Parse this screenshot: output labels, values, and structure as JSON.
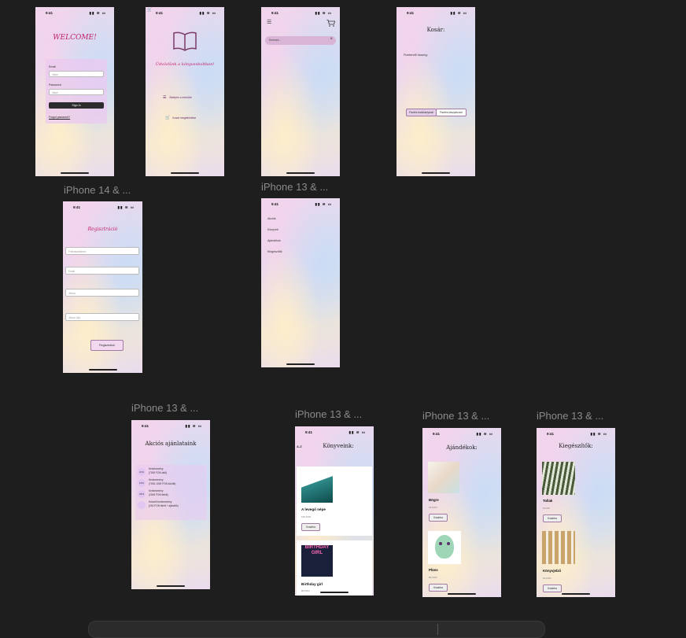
{
  "status": {
    "time": "9:41",
    "icons": "▮▮ ≋ ▭"
  },
  "labels": {
    "iphone14": "iPhone 14 & ...",
    "iphone13a": "iPhone 13 & ...",
    "iphone13b": "iPhone 13 & ...",
    "iphone13c": "iPhone 13 & ...",
    "iphone13d": "iPhone 13 & ...",
    "iphone13e": "iPhone 13 & ...",
    "iphone13f": "iPhone 13 & ..."
  },
  "login": {
    "title": "WELCOME!",
    "email_label": "Email",
    "email_placeholder": "Value",
    "password_label": "Password",
    "password_placeholder": "Value",
    "signin": "Sign In",
    "forgot": "Forgot password?"
  },
  "welcome": {
    "subtitle": "Üdvözlünk a könyvesboltban!",
    "menu1": "Belépés a menübe",
    "menu2": "Kosár megtekintése"
  },
  "search": {
    "placeholder": "Keresés...",
    "clear": "×"
  },
  "cart": {
    "title": "Kosár:",
    "total_label": "Fizetendő összeg:",
    "btn_card": "Fizetés bankkártyával",
    "btn_cash": "Fizetés készpénzzel"
  },
  "register": {
    "title": "Regisztráció",
    "username": "Felhasználónév",
    "email": "Email",
    "password": "Jelszó",
    "password2": "Jelszó újra",
    "submit": "Regisztrálok"
  },
  "menu": {
    "items": [
      "Akciók",
      "Könyvek",
      "Ajándékok",
      "Kiegészítők"
    ]
  },
  "offers": {
    "title": "Akciós ajánlataink",
    "items": [
      {
        "badge": "10%",
        "line1": "Kedvezmény",
        "line2": "(7000 FON-ától)"
      },
      {
        "badge": "15%",
        "line1": "Kedvezmény",
        "line2": "(7000-1000 FON között)"
      },
      {
        "badge": "25%",
        "line1": "Kedvezmény",
        "line2": "(2000 FON felett)"
      },
      {
        "badge": "",
        "line1": "Húsvéti kedvezmény",
        "line2": "(200 FON felett + ajándék)"
      }
    ]
  },
  "books": {
    "sort": "A-Z",
    "title": "Könyveink:",
    "items": [
      {
        "name": "A levegő népe",
        "price": "100 FON",
        "btn": "Kosárba",
        "cover_text": ""
      },
      {
        "name": "Birthday girl",
        "price": "80 FON",
        "btn": "Kosárba",
        "cover_text": "BIRTHDAY GIRL"
      }
    ]
  },
  "gifts": {
    "title": "Ajándékok:",
    "items": [
      {
        "name": "Bögre",
        "price": "19 FON",
        "btn": "Kosárba"
      },
      {
        "name": "Plüss",
        "price": "50 FON",
        "btn": "Kosárba"
      }
    ]
  },
  "accessories": {
    "title": "Kiegészítők:",
    "items": [
      {
        "name": "Tollak",
        "price": "5 FON",
        "btn": "Kosárba"
      },
      {
        "name": "Könyvjelző",
        "price": "10 FON",
        "btn": "Kosárba"
      }
    ]
  }
}
